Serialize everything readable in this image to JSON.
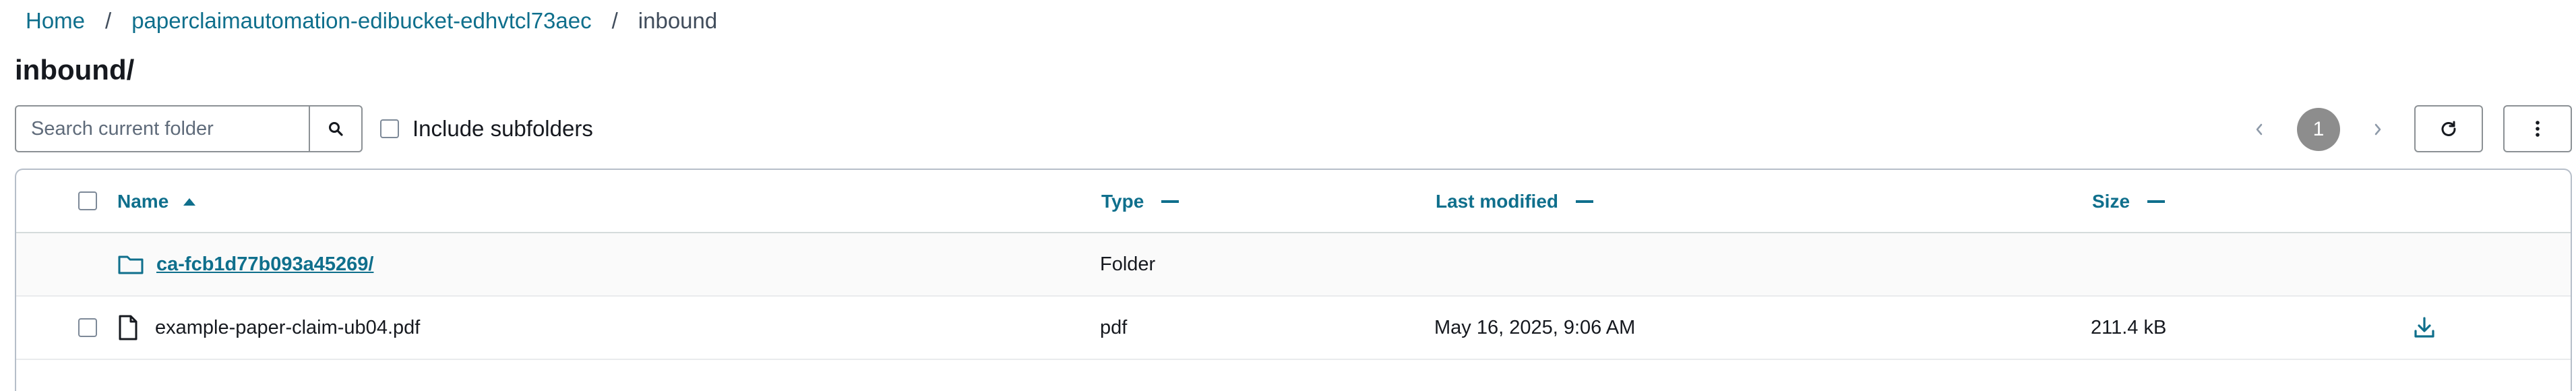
{
  "breadcrumb": {
    "home": "Home",
    "sep1": "/",
    "bucket": "paperclaimautomation-edibucket-edhvtcl73aec",
    "sep2": "/",
    "current": "inbound"
  },
  "page_title": "inbound/",
  "search": {
    "placeholder": "Search current folder",
    "value": ""
  },
  "include_subfolders": {
    "label": "Include subfolders",
    "checked": false
  },
  "pagination": {
    "current_page": "1",
    "prev": "‹",
    "next": "›"
  },
  "table": {
    "columns": [
      {
        "label": "Name",
        "sort": "ascending"
      },
      {
        "label": "Type",
        "sort": "none"
      },
      {
        "label": "Last modified",
        "sort": "none"
      },
      {
        "label": "Size",
        "sort": "none"
      }
    ],
    "rows": [
      {
        "kind": "folder",
        "name": "ca-fcb1d77b093a45269/",
        "type": "Folder",
        "last_modified": "",
        "size": ""
      },
      {
        "kind": "file",
        "name": "example-paper-claim-ub04.pdf",
        "type": "pdf",
        "last_modified": "May 16, 2025, 9:06 AM",
        "size": "211.4 kB"
      }
    ]
  },
  "icons": {
    "search": "search-icon",
    "refresh": "refresh-icon",
    "more": "more-vertical-icon",
    "folder": "folder-icon",
    "file": "file-icon",
    "download": "download-icon"
  },
  "colors": {
    "link": "#0f6f8c",
    "border": "#8c9195",
    "page_badge": "#8d8d8d"
  }
}
